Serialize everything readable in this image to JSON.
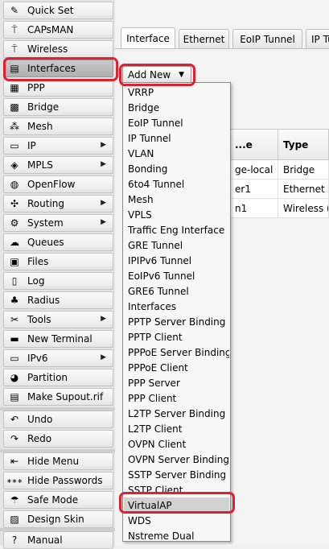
{
  "sidebar": {
    "items": [
      {
        "label": "Quick Set",
        "icon": "quick-set-icon",
        "glyph": "✎",
        "submenu": false
      },
      {
        "label": "CAPsMAN",
        "icon": "capsman-icon",
        "glyph": "⍑",
        "submenu": false
      },
      {
        "label": "Wireless",
        "icon": "wireless-icon",
        "glyph": "⍑",
        "submenu": false
      },
      {
        "label": "Interfaces",
        "icon": "interfaces-icon",
        "glyph": "▤",
        "submenu": false,
        "active": true
      },
      {
        "label": "PPP",
        "icon": "ppp-icon",
        "glyph": "▦",
        "submenu": false
      },
      {
        "label": "Bridge",
        "icon": "bridge-icon",
        "glyph": "▩",
        "submenu": false
      },
      {
        "label": "Mesh",
        "icon": "mesh-icon",
        "glyph": "⁂",
        "submenu": false
      },
      {
        "label": "IP",
        "icon": "ip-icon",
        "glyph": "▭",
        "submenu": true
      },
      {
        "label": "MPLS",
        "icon": "mpls-icon",
        "glyph": "◈",
        "submenu": true
      },
      {
        "label": "OpenFlow",
        "icon": "openflow-icon",
        "glyph": "◍",
        "submenu": false
      },
      {
        "label": "Routing",
        "icon": "routing-icon",
        "glyph": "✣",
        "submenu": true
      },
      {
        "label": "System",
        "icon": "system-icon",
        "glyph": "⚙",
        "submenu": true
      },
      {
        "label": "Queues",
        "icon": "queues-icon",
        "glyph": "☁",
        "submenu": false
      },
      {
        "label": "Files",
        "icon": "files-icon",
        "glyph": "▣",
        "submenu": false
      },
      {
        "label": "Log",
        "icon": "log-icon",
        "glyph": "▯",
        "submenu": false
      },
      {
        "label": "Radius",
        "icon": "radius-icon",
        "glyph": "♣",
        "submenu": false
      },
      {
        "label": "Tools",
        "icon": "tools-icon",
        "glyph": "✂",
        "submenu": true
      },
      {
        "label": "New Terminal",
        "icon": "terminal-icon",
        "glyph": "▬",
        "submenu": false
      },
      {
        "label": "IPv6",
        "icon": "ipv6-icon",
        "glyph": "▭",
        "submenu": true
      },
      {
        "label": "Partition",
        "icon": "partition-icon",
        "glyph": "◕",
        "submenu": false
      },
      {
        "label": "Make Supout.rif",
        "icon": "supout-icon",
        "glyph": "▤",
        "submenu": false
      },
      {
        "label": "Undo",
        "icon": "undo-icon",
        "glyph": "↶",
        "submenu": false
      },
      {
        "label": "Redo",
        "icon": "redo-icon",
        "glyph": "↷",
        "submenu": false
      },
      {
        "label": "Hide Menu",
        "icon": "hide-menu-icon",
        "glyph": "⇤",
        "submenu": false
      },
      {
        "label": "Hide Passwords",
        "icon": "hide-passwords-icon",
        "glyph": "∗∗∗",
        "submenu": false
      },
      {
        "label": "Safe Mode",
        "icon": "safe-mode-icon",
        "glyph": "☂",
        "submenu": false
      },
      {
        "label": "Design Skin",
        "icon": "design-skin-icon",
        "glyph": "▨",
        "submenu": false
      },
      {
        "label": "Manual",
        "icon": "manual-icon",
        "glyph": "?",
        "submenu": false
      }
    ]
  },
  "tabs": [
    "Interface",
    "Ethernet",
    "EoIP Tunnel",
    "IP Tunnel"
  ],
  "add_new": {
    "label": "Add New",
    "arrow": "▼"
  },
  "submenu_arrow": "▶",
  "table": {
    "headers": [
      "...e",
      "Type"
    ],
    "rows": [
      [
        "ge-local",
        "Bridge"
      ],
      [
        "er1",
        "Ethernet"
      ],
      [
        "n1",
        "Wireless ("
      ]
    ]
  },
  "dropdown": {
    "items": [
      "VRRP",
      "Bridge",
      "EoIP Tunnel",
      "IP Tunnel",
      "VLAN",
      "Bonding",
      "6to4 Tunnel",
      "Mesh",
      "VPLS",
      "Traffic Eng Interface",
      "GRE Tunnel",
      "IPIPv6 Tunnel",
      "EoIPv6 Tunnel",
      "GRE6 Tunnel",
      "Interfaces",
      "PPTP Server Binding",
      "PPTP Client",
      "PPPoE Server Binding",
      "PPPoE Client",
      "PPP Server",
      "PPP Client",
      "L2TP Server Binding",
      "L2TP Client",
      "OVPN Client",
      "OVPN Server Binding",
      "SSTP Server Binding",
      "SSTP Client",
      "VirtualAP",
      "WDS",
      "Nstreme Dual"
    ],
    "highlighted": "VirtualAP"
  },
  "colors": {
    "highlight_ring": "#e0202c"
  }
}
